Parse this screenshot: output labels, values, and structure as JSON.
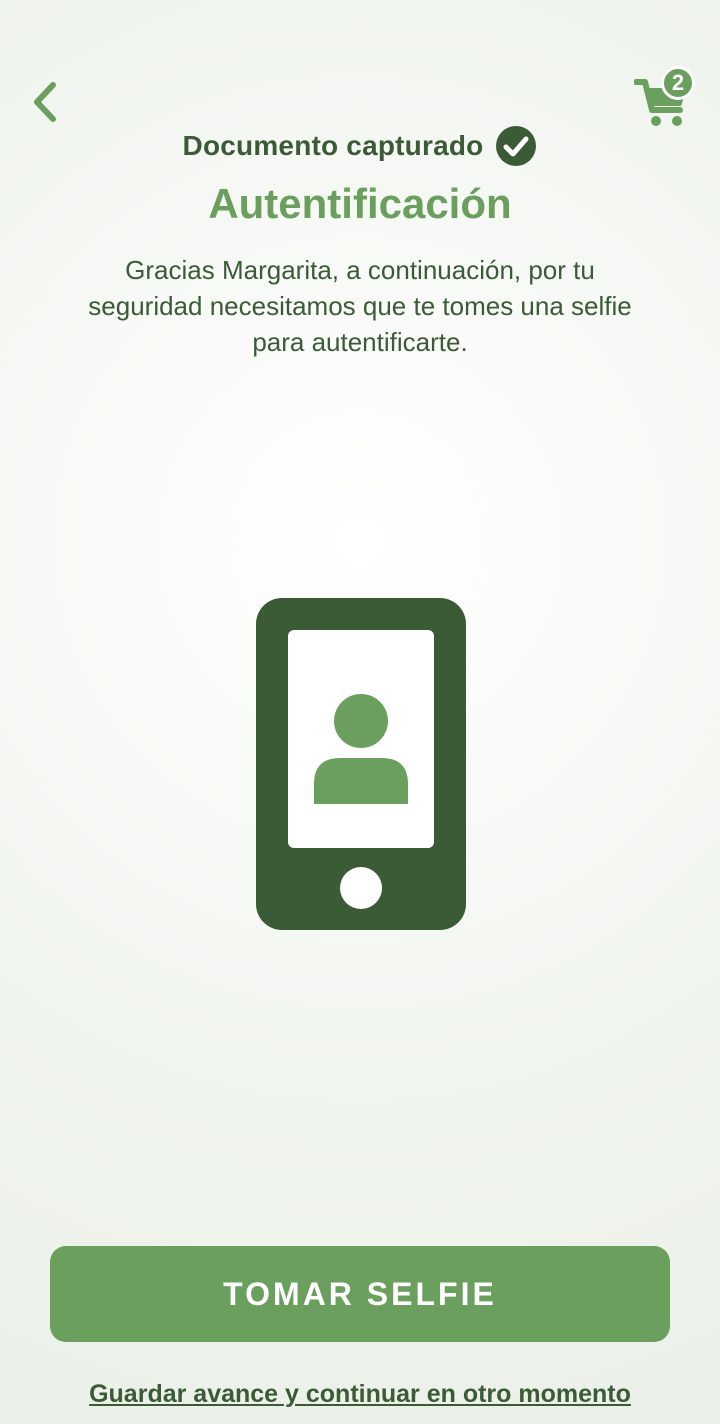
{
  "header": {
    "back_icon": "chevron-left-icon",
    "cart_icon": "shopping-cart-icon",
    "cart_count": "2"
  },
  "status": {
    "text": "Documento capturado",
    "icon": "check-circle-icon"
  },
  "title": "Autentificación",
  "description": "Gracias Margarita, a continuación, por tu seguridad necesitamos que te tomes una selfie para  autentificarte.",
  "illustration": {
    "icon": "phone-selfie-icon"
  },
  "actions": {
    "primary_label": "TOMAR SELFIE",
    "secondary_label": "Guardar avance y continuar en otro momento"
  },
  "colors": {
    "brand_green": "#6b9f5e",
    "dark_green": "#3b5a36"
  }
}
